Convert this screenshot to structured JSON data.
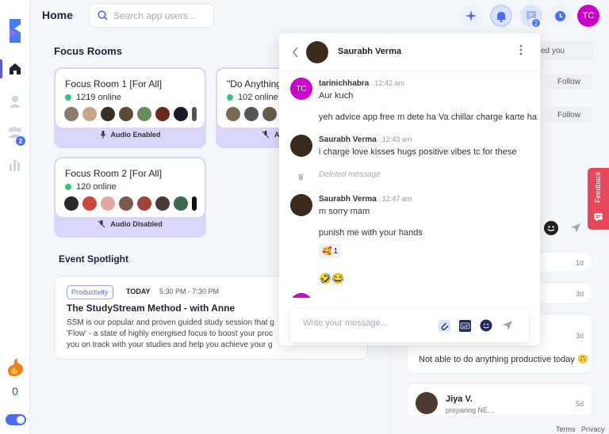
{
  "header": {
    "title": "Home",
    "search_placeholder": "Search app users...",
    "avatar_initials": "TC",
    "messages_badge": "2"
  },
  "sidebar": {
    "groups_badge": "2",
    "streak_count": "0"
  },
  "focus_rooms": {
    "title": "Focus Rooms",
    "rooms": [
      {
        "name": "Focus Room 1 [For All]",
        "online": "1219 online",
        "audio": "Audio Enabled"
      },
      {
        "name": "\"Do Anything",
        "online": "102 online",
        "audio": "A"
      },
      {
        "name": "Focus Room 2 [For All]",
        "online": "120 online",
        "audio": "Audio Disabled"
      }
    ]
  },
  "event_spotlight": {
    "title": "Event Spotlight",
    "tag": "Productivity",
    "day": "TODAY",
    "time": "5:30 PM - 7:30 PM",
    "event_title": "The StudyStream Method - with Anne",
    "description": "SSM is our popular and proven guided study session that g\n'Flow' - a state of highly energised focus to boost your proc\nyou on track with your studies and help you achieve your g"
  },
  "right_panel": {
    "tab_text": "ed you",
    "follow_label": "Follow",
    "feed_ages": [
      "1d",
      "3d",
      "3d",
      "5d"
    ],
    "post_text": "Not able to do anything productive today 🙃",
    "user_name": "Jiya V.",
    "user_status": "preparing NE...",
    "feedback_label": "Feedback"
  },
  "chat": {
    "contact_name": "Saurabh Verma",
    "messages": [
      {
        "sender": "tarinichhabra",
        "time": "12:42 am",
        "avatar_initials": "TC",
        "text": "Aur kuch"
      },
      {
        "text": "yeh advice app free m dete ha Va chillar charge karte ha"
      },
      {
        "sender": "Saurabh Verma",
        "time": "12:43 am",
        "text": "i charge love kisses hugs positive vibes tc for these"
      },
      {
        "deleted": "Deleted message"
      },
      {
        "sender": "Saurabh Verma",
        "time": "12:47 am",
        "text": "m sorry mam"
      },
      {
        "text": "punish me with your hands"
      },
      {
        "reaction": "🥰",
        "reaction_count": "1"
      },
      {
        "text": "🤣😂"
      }
    ],
    "composer_placeholder": "Write your message..."
  },
  "footer": {
    "terms": "Terms",
    "privacy": "Privacy"
  },
  "colors": {
    "accent": "#5b5bd6",
    "room_bg": "#d9d5fb",
    "avatar": "#cc00cc",
    "feedback": "#e8465a",
    "online": "#2ecc71"
  }
}
